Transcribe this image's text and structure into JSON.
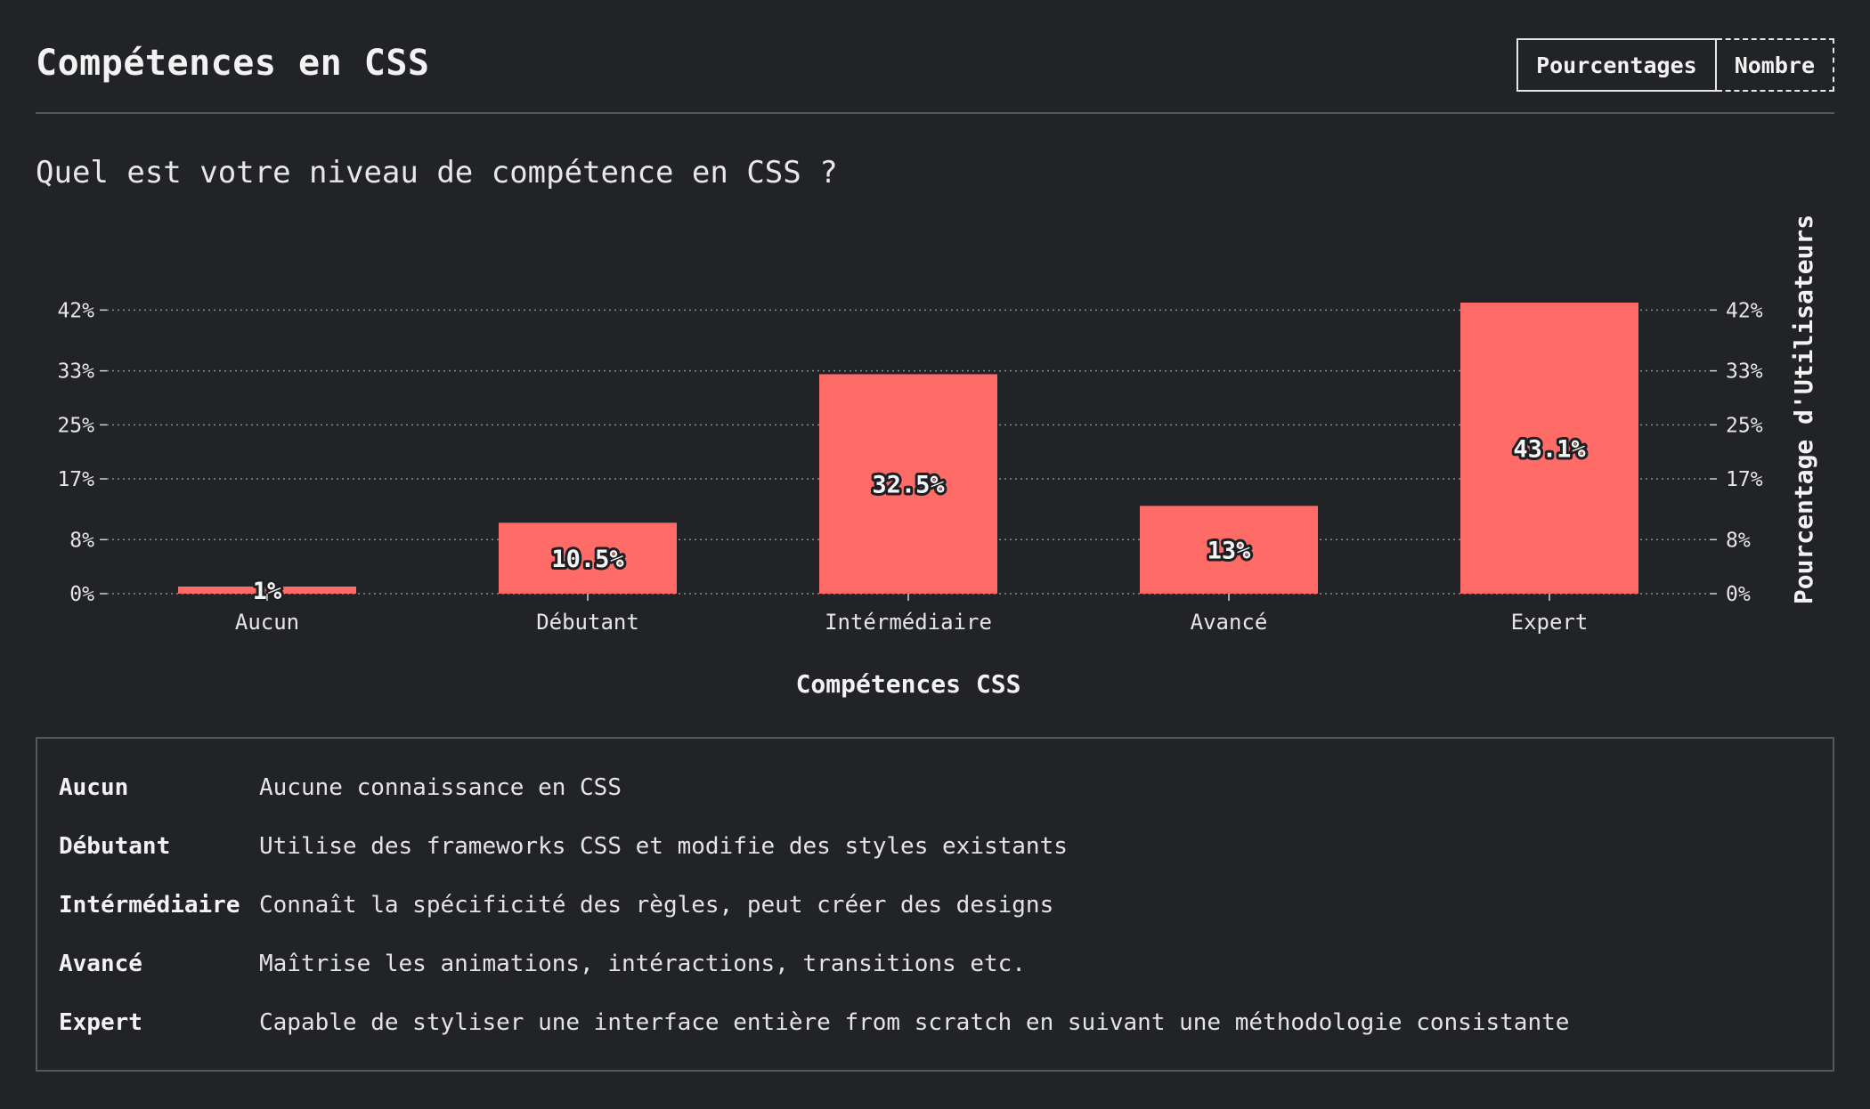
{
  "header": {
    "title": "Compétences en CSS",
    "toggle": {
      "percent_label": "Pourcentages",
      "count_label": "Nombre"
    }
  },
  "question": "Quel est votre niveau de compétence en CSS ?",
  "chart_data": {
    "type": "bar",
    "categories": [
      "Aucun",
      "Débutant",
      "Intérmédiaire",
      "Avancé",
      "Expert"
    ],
    "values": [
      1,
      10.5,
      32.5,
      13,
      43.1
    ],
    "value_labels": [
      "1%",
      "10.5%",
      "32.5%",
      "13%",
      "43.1%"
    ],
    "xlabel": "Compétences CSS",
    "ylabel": "Pourcentage d'Utilisateurs",
    "yticks": [
      0,
      8,
      17,
      25,
      33,
      42
    ],
    "ytick_labels": [
      "0%",
      "8%",
      "17%",
      "25%",
      "33%",
      "42%"
    ],
    "ylim": [
      0,
      43.1
    ],
    "grid": true,
    "bar_color": "#ff6b67"
  },
  "legend": [
    {
      "term": "Aucun",
      "desc": "Aucune connaissance en CSS"
    },
    {
      "term": "Débutant",
      "desc": "Utilise des frameworks CSS et modifie des styles existants"
    },
    {
      "term": "Intérmédiaire",
      "desc": "Connaît la spécificité des règles, peut créer des designs"
    },
    {
      "term": "Avancé",
      "desc": "Maîtrise les animations, intéractions, transitions etc."
    },
    {
      "term": "Expert",
      "desc": "Capable de styliser une interface entière from scratch en suivant une méthodologie consistante"
    }
  ]
}
